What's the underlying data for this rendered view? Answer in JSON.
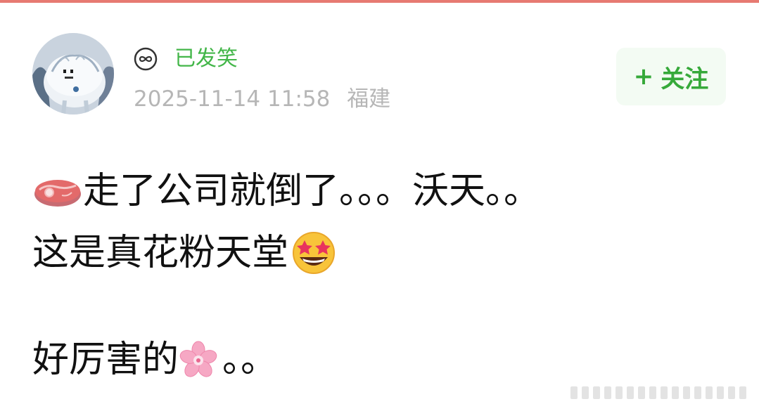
{
  "post": {
    "status_label": "已发笑",
    "timestamp": "2025-11-14 11:58",
    "location": "福建",
    "follow_label": "关注",
    "follow_plus": "+"
  },
  "content": {
    "line1_text": "走了公司就倒了。。。沃天。。",
    "line2_text": "这是真花粉天堂 ",
    "line3_text": "好厉害的",
    "line3_tail": "。。"
  },
  "icons": {
    "avatar": "cartoon-avatar-icon",
    "vip": "infinity-badge-icon",
    "meat": "meat-steak-emoji",
    "star_eyes": "star-struck-emoji",
    "flower": "cherry-blossom-emoji"
  },
  "colors": {
    "accent_green": "#43b649",
    "follow_bg": "#f3fbf3",
    "meta_gray": "#b6b6b6",
    "top_bar": "#e77a72"
  }
}
